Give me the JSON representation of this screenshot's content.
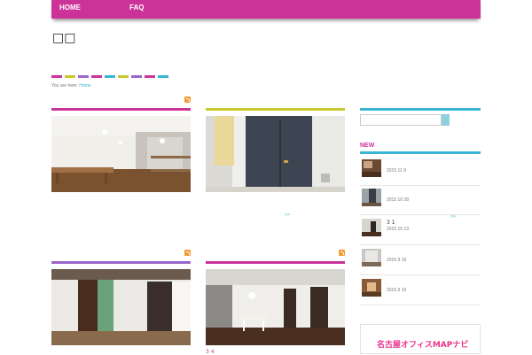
{
  "nav": {
    "items": [
      {
        "label": "HOME"
      },
      {
        "label": "FAQ"
      }
    ]
  },
  "page": {
    "title": "□□",
    "stripe_colors": [
      "#cc3399",
      "#c8c830",
      "#9966cc",
      "#cc3399",
      "#39b5d3",
      "#c8c830",
      "#9966cc",
      "#cc3399",
      "#39b5d3",
      "#cc3399"
    ]
  },
  "breadcrumb": {
    "prefix": "You are here:",
    "home_link": "Home"
  },
  "posts": [
    {
      "bar_color": "#cc3399"
    },
    {
      "bar_color": "#c8c830",
      "more": ">>"
    },
    {
      "bar_color": "#9966cc"
    },
    {
      "bar_color": "#cc3399",
      "caption": "3 4"
    }
  ],
  "sidebar": {
    "search": {
      "placeholder": ""
    },
    "new_section": {
      "title": "NEW",
      "items": [
        {
          "title": "",
          "date": "2015 11 9"
        },
        {
          "title": "",
          "date": "2015 10 28"
        },
        {
          "title": "3 1",
          "date": "2015 10 13",
          "more": ">>"
        },
        {
          "title": "",
          "date": "2015 9 16"
        },
        {
          "title": "",
          "date": "2015 9 10"
        }
      ]
    },
    "banner": {
      "label": "名古屋オフィスMAPナビ"
    }
  },
  "colors": {
    "brand_magenta": "#cc3399",
    "accent_cyan": "#39b5d3",
    "accent_yellow": "#c8c830",
    "accent_purple": "#9966cc"
  }
}
